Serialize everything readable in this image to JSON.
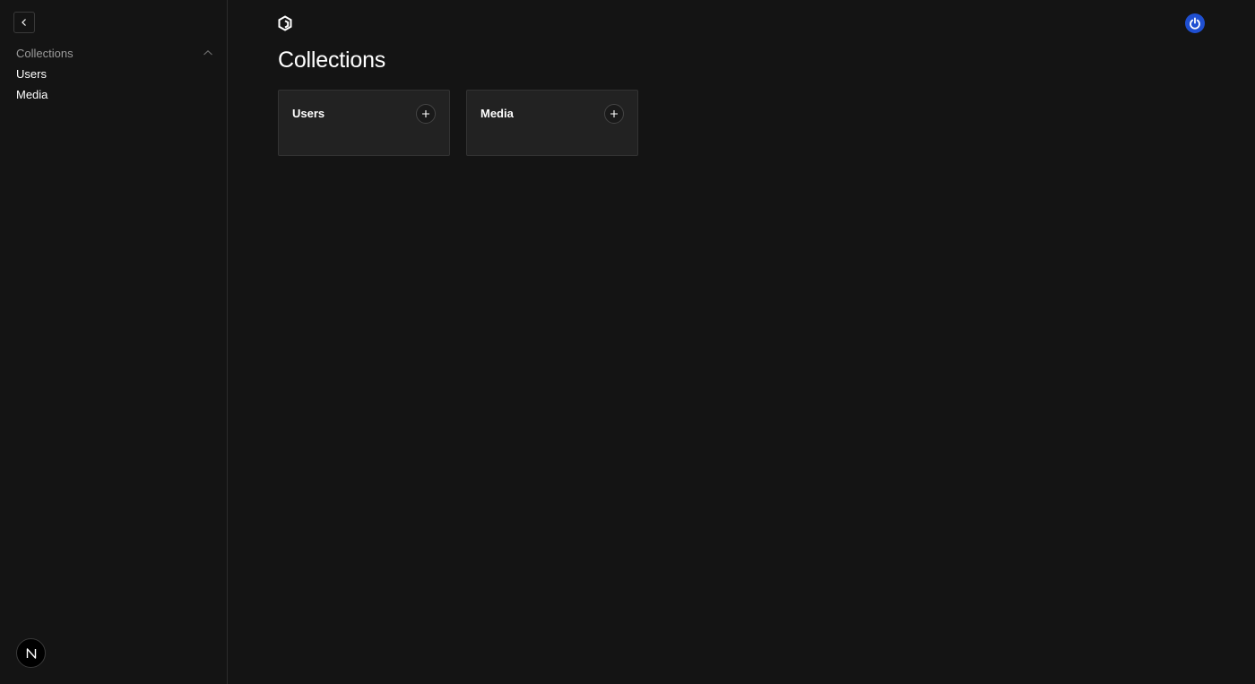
{
  "sidebar": {
    "collapse_icon": "chevron-left-icon",
    "group": {
      "label": "Collections",
      "toggle_icon": "chevron-up-icon"
    },
    "links": [
      {
        "label": "Users"
      },
      {
        "label": "Media"
      }
    ],
    "footer_badge_icon": "nextjs-logo-icon"
  },
  "header": {
    "logo_icon": "payload-logo-icon",
    "account_icon": "power-icon",
    "account_color": "#1f4fd1"
  },
  "main": {
    "title": "Collections",
    "cards": [
      {
        "title": "Users",
        "add_icon": "plus-icon"
      },
      {
        "title": "Media",
        "add_icon": "plus-icon"
      }
    ]
  },
  "colors": {
    "background": "#141414",
    "card": "#222222",
    "muted_text": "#9a9a9a"
  }
}
